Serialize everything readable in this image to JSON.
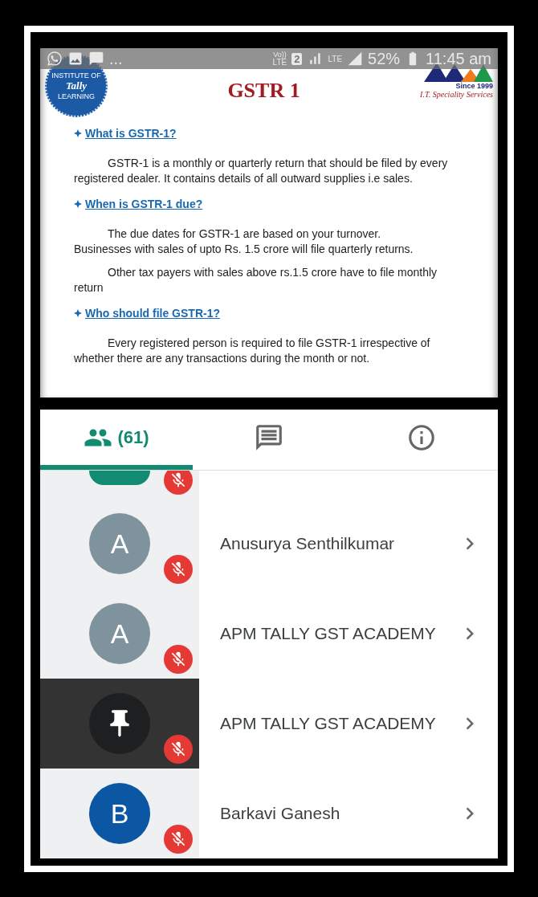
{
  "status_bar": {
    "overflow": "...",
    "volte_top": "Vo))",
    "volte_bottom": "LTE",
    "sim": "2",
    "network": "LTE",
    "battery": "52%",
    "time": "11:45 am"
  },
  "slide": {
    "title": "GSTR 1",
    "left_logo": {
      "top": "INSTITUTE OF",
      "brand": "Tally",
      "bottom": "LEARNING"
    },
    "right_logo": {
      "since": "Since 1999",
      "tagline": "I.T. Speciality Services"
    },
    "sections": [
      {
        "heading": "What is GSTR-1?",
        "paragraphs": [
          [
            "GSTR-1 is a monthly or quarterly return that should be filed by every",
            "registered dealer. It contains details of all outward supplies i.e sales."
          ]
        ]
      },
      {
        "heading": "When is GSTR-1 due?",
        "paragraphs": [
          [
            "The due dates for GSTR-1 are based on your turnover.",
            "Businesses with sales of upto Rs. 1.5 crore will file quarterly returns."
          ],
          [
            "Other tax payers with sales above rs.1.5 crore have to file  monthly",
            "return"
          ]
        ]
      },
      {
        "heading": "Who should file GSTR-1?",
        "paragraphs": [
          [
            "Every registered person is required to file GSTR-1 irrespective of",
            "whether there are any transactions during the month or not."
          ]
        ]
      }
    ]
  },
  "tabs": [
    {
      "kind": "people",
      "label": "(61)",
      "selected": true
    },
    {
      "kind": "chat",
      "selected": false
    },
    {
      "kind": "info",
      "selected": false
    }
  ],
  "participants": [
    {
      "kind": "cut",
      "color": "#138a72",
      "muted": true,
      "presenting": false
    },
    {
      "kind": "initial",
      "initial": "A",
      "name": "Anusurya Senthilkumar",
      "color": "#7f939e",
      "muted": true,
      "presenting": false
    },
    {
      "kind": "initial",
      "initial": "A",
      "name": "APM TALLY GST ACADEMY",
      "color": "#7f939e",
      "muted": true,
      "presenting": false
    },
    {
      "kind": "pin",
      "name": "APM TALLY GST ACADEMY",
      "color": "#1e1f20",
      "muted": true,
      "presenting": true
    },
    {
      "kind": "initial",
      "initial": "B",
      "name": "Barkavi Ganesh",
      "color": "#0b57a4",
      "muted": true,
      "presenting": false
    }
  ]
}
